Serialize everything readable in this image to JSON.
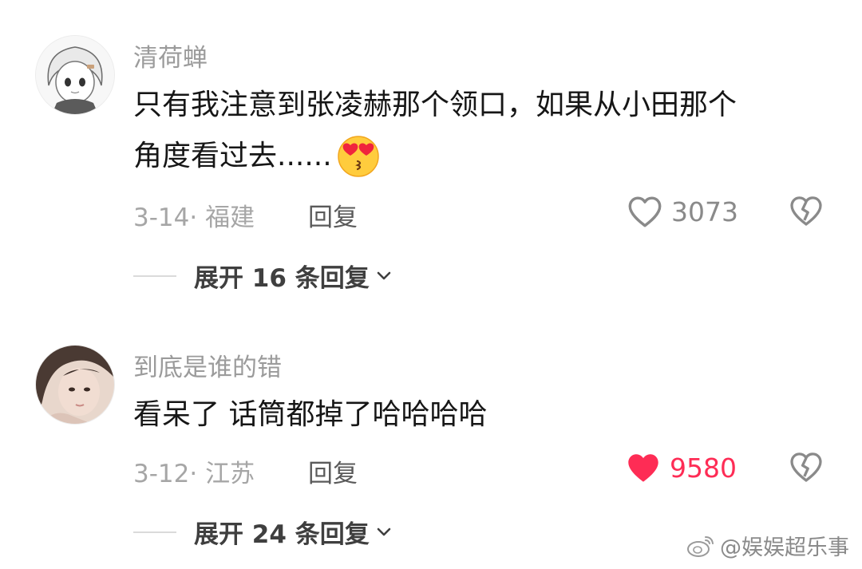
{
  "comments": [
    {
      "username": "清荷蝉",
      "text_line1": "只有我注意到张凌赫那个领口，如果从小田那个",
      "text_line2": "角度看过去......",
      "meta": "3-14· 福建",
      "reply_label": "回复",
      "likes": "3073",
      "liked": false,
      "expand_label": "展开 16 条回复"
    },
    {
      "username": "到底是谁的错",
      "text_line1": "看呆了 话筒都掉了哈哈哈哈",
      "meta": "3-12· 江苏",
      "reply_label": "回复",
      "likes": "9580",
      "liked": true,
      "expand_label": "展开 24 条回复"
    }
  ],
  "colors": {
    "like_active": "#fe2c55",
    "like_inactive": "#8a8a8a"
  },
  "icons": [
    "heart-outline-icon",
    "heart-filled-icon",
    "broken-heart-icon",
    "chevron-down-icon",
    "kissing-heart-eyes-emoji",
    "weibo-icon"
  ],
  "watermark": "@娱娱超乐事"
}
